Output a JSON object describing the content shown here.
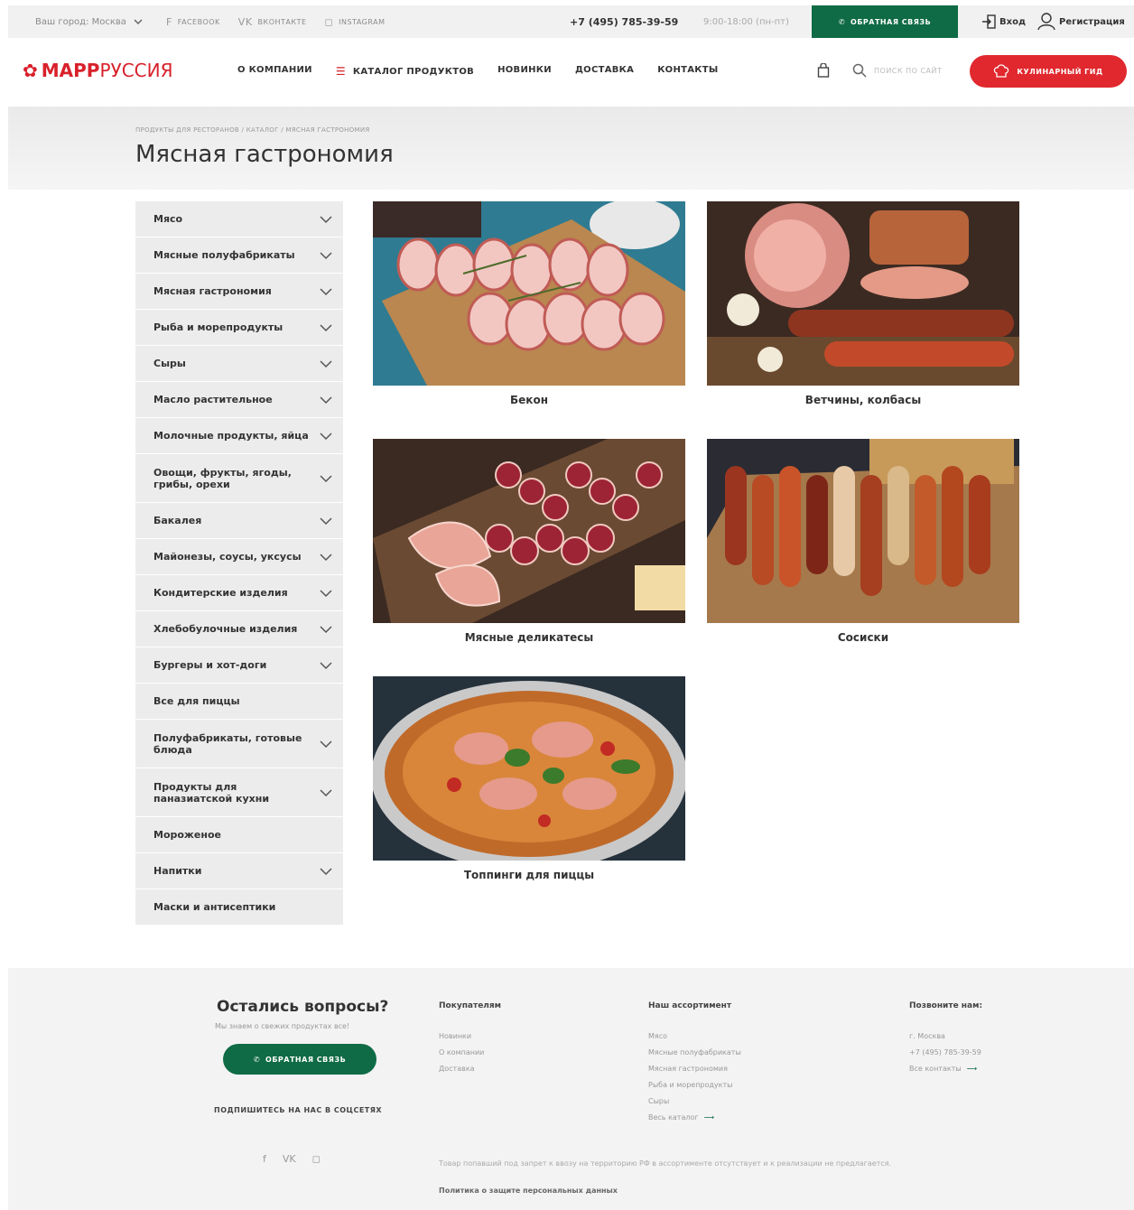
{
  "topbar": {
    "city_label": "Ваш город: Москва",
    "socials": [
      {
        "icon": "facebook-icon",
        "glyph": "f",
        "label": "FACEBOOK"
      },
      {
        "icon": "vk-icon",
        "glyph": "VK",
        "label": "ВКОНТАКТЕ"
      },
      {
        "icon": "instagram-icon",
        "glyph": "◻",
        "label": "INSTAGRAM"
      }
    ],
    "phone": "+7 (495) 785-39-59",
    "hours": "9:00-18:00 (пн-пт)",
    "callback_label": "ОБРАТНАЯ СВЯЗЬ",
    "login_label": "Вход",
    "register_label": "Регистрация"
  },
  "header": {
    "logo_bold": "МАРР",
    "logo_thin": "РУССИЯ",
    "nav": [
      "О КОМПАНИИ",
      "КАТАЛОГ ПРОДУКТОВ",
      "НОВИНКИ",
      "ДОСТАВКА",
      "КОНТАКТЫ"
    ],
    "search_placeholder": "ПОИСК ПО САЙТ",
    "guide_label": "КУЛИНАРНЫЙ ГИД"
  },
  "hero": {
    "breadcrumb": "ПРОДУКТЫ ДЛЯ РЕСТОРАНОВ / КАТАЛОГ / МЯСНАЯ ГАСТРОНОМИЯ",
    "title": "Мясная гастрономия"
  },
  "sidebar": [
    {
      "label": "Мясо",
      "chevron": true,
      "tall": false
    },
    {
      "label": "Мясные полуфабрикаты",
      "chevron": true,
      "tall": false
    },
    {
      "label": "Мясная гастрономия",
      "chevron": true,
      "tall": false
    },
    {
      "label": "Рыба и морепродукты",
      "chevron": true,
      "tall": false
    },
    {
      "label": "Сыры",
      "chevron": true,
      "tall": false
    },
    {
      "label": "Масло растительное",
      "chevron": true,
      "tall": false
    },
    {
      "label": "Молочные продукты, яйца",
      "chevron": true,
      "tall": false
    },
    {
      "label": "Овощи, фрукты, ягоды, грибы, орехи",
      "chevron": true,
      "tall": true
    },
    {
      "label": "Бакалея",
      "chevron": true,
      "tall": false
    },
    {
      "label": "Майонезы, соусы, уксусы",
      "chevron": true,
      "tall": false
    },
    {
      "label": "Кондитерские изделия",
      "chevron": true,
      "tall": false
    },
    {
      "label": "Хлебобулочные изделия",
      "chevron": true,
      "tall": false
    },
    {
      "label": "Бургеры и хот-доги",
      "chevron": true,
      "tall": false
    },
    {
      "label": "Все для пиццы",
      "chevron": false,
      "tall": false
    },
    {
      "label": "Полуфабрикаты, готовые блюда",
      "chevron": true,
      "tall": true
    },
    {
      "label": "Продукты для паназиатской кухни",
      "chevron": true,
      "tall": true
    },
    {
      "label": "Мороженое",
      "chevron": false,
      "tall": false
    },
    {
      "label": "Напитки",
      "chevron": true,
      "tall": false
    },
    {
      "label": "Маски и антисептики",
      "chevron": false,
      "tall": false
    }
  ],
  "cards": [
    {
      "caption": "Бекон",
      "kind": "bacon"
    },
    {
      "caption": "Ветчины, колбасы",
      "kind": "ham"
    },
    {
      "caption": "Мясные деликатесы",
      "kind": "deli"
    },
    {
      "caption": "Сосиски",
      "kind": "sausages"
    },
    {
      "caption": "Топпинги для пиццы",
      "kind": "pizza"
    }
  ],
  "footer": {
    "question": "Остались вопросы?",
    "subtitle": "Мы знаем о свежих продуктах все!",
    "callback_label": "ОБРАТНАЯ СВЯЗЬ",
    "subscribe": "ПОДПИШИТЕСЬ НА НАС В СОЦСЕТЯХ",
    "socials": [
      "f",
      "VK",
      "◻"
    ],
    "col_buyers": {
      "title": "Покупателям",
      "links": [
        "Новинки",
        "О компании",
        "Доставка"
      ]
    },
    "col_range": {
      "title": "Наш ассортимент",
      "links": [
        "Мясо",
        "Мясные полуфабрикаты",
        "Мясная гастрономия",
        "Рыба и морепродукты",
        "Сыры",
        "Весь каталог"
      ]
    },
    "col_call": {
      "title": "Позвоните нам:",
      "links": [
        "г. Москва",
        "+7 (495) 785-39-59",
        "Все контакты"
      ]
    },
    "legal": "Товар попавший под запрет к ввозу на территорию РФ в ассортименте отсутствует и к реализации не предлагается.",
    "privacy": "Политика о защите персональных данных"
  }
}
